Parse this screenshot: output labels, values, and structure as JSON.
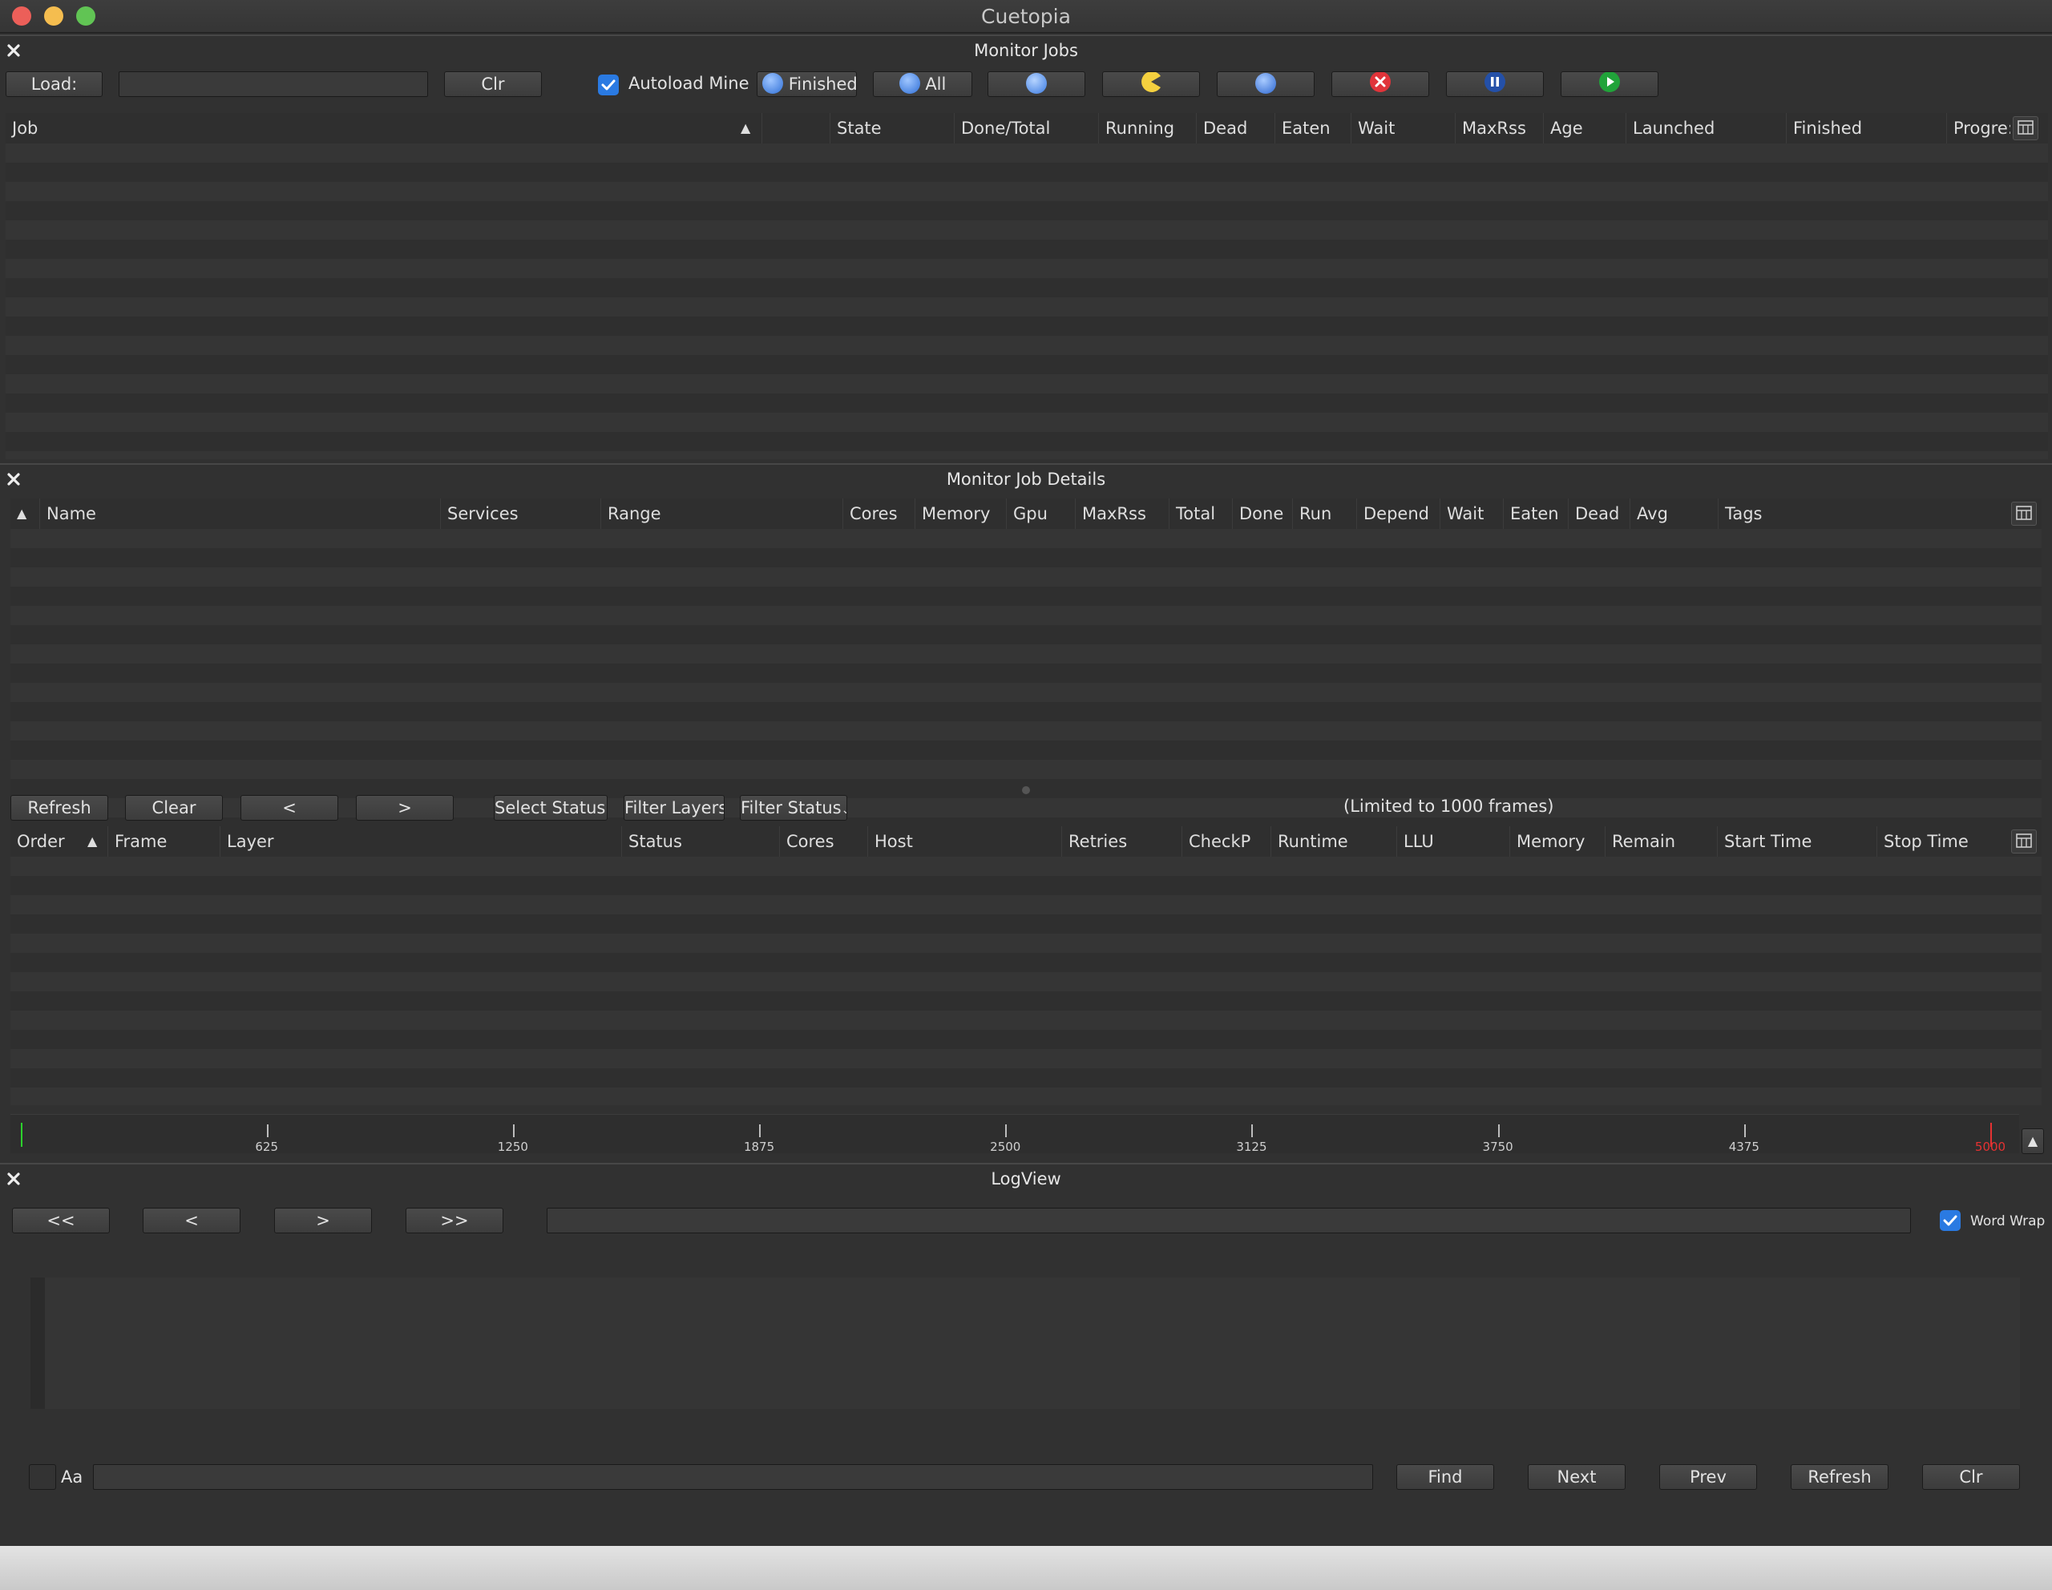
{
  "window": {
    "title": "Cuetopia"
  },
  "colors": {
    "accent": "#2a7ae2",
    "close_red": "#ec5f59",
    "min_yellow": "#f5bd4f",
    "max_green": "#61c454",
    "timeline_start": "#2cd12c",
    "timeline_end": "#e53232"
  },
  "monitor_jobs": {
    "title": "Monitor Jobs",
    "toolbar": {
      "load_label": "Load:",
      "load_value": "",
      "clr_label": "Clr",
      "autoload_label": "Autoload Mine",
      "autoload_checked": true,
      "finished_label": "Finished",
      "all_label": "All",
      "icons": [
        "unmonitor-icon",
        "eat-icon",
        "retry-icon",
        "kill-icon",
        "pause-icon",
        "unpause-icon"
      ]
    },
    "columns": [
      "Job",
      "State",
      "Done/Total",
      "Running",
      "Dead",
      "Eaten",
      "Wait",
      "MaxRss",
      "Age",
      "Launched",
      "Finished",
      "Progre:"
    ]
  },
  "job_details": {
    "title": "Monitor Job Details",
    "layer_columns": [
      "Name",
      "Services",
      "Range",
      "Cores",
      "Memory",
      "Gpu",
      "MaxRss",
      "Total",
      "Done",
      "Run",
      "Depend",
      "Wait",
      "Eaten",
      "Dead",
      "Avg",
      "Tags"
    ],
    "frame_toolbar": {
      "refresh": "Refresh",
      "clear": "Clear",
      "prev": "<",
      "next": ">",
      "select_status": "Select Status",
      "filter_layers": "Filter Layers",
      "filter_status": "Filter Status",
      "limit_note": "(Limited to 1000 frames)"
    },
    "frame_columns": [
      "Order",
      "Frame",
      "Layer",
      "Status",
      "Cores",
      "Host",
      "Retries",
      "CheckP",
      "Runtime",
      "LLU",
      "Memory",
      "Remain",
      "Start Time",
      "Stop Time"
    ],
    "timeline": {
      "min": 1,
      "max": 5000,
      "ticks": [
        "625",
        "1250",
        "1875",
        "2500",
        "3125",
        "3750",
        "4375"
      ]
    }
  },
  "logview": {
    "title": "LogView",
    "nav": {
      "first": "<<",
      "prev": "<",
      "next": ">",
      "last": ">>"
    },
    "path_value": "",
    "word_wrap_label": "Word Wrap",
    "word_wrap_checked": true,
    "search": {
      "case_label": "Aa",
      "value": "",
      "find": "Find",
      "next": "Next",
      "prev": "Prev",
      "refresh": "Refresh",
      "clr": "Clr"
    }
  }
}
